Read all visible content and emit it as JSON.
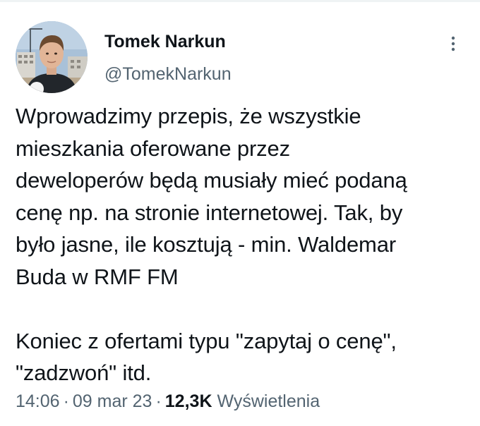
{
  "author": {
    "display_name": "Tomek Narkun",
    "handle": "@TomekNarkun"
  },
  "tweet": {
    "text": "Wprowadzimy przepis, że wszystkie\nmieszkania oferowane przez\ndeweloperów będą musiały mieć podaną\ncenę np. na stronie internetowej. Tak, by\nbyło jasne, ile kosztują - min. Waldemar\nBuda w RMF FM\n\nKoniec z ofertami typu \"zapytaj o cenę\",\n\"zadzwoń\" itd.",
    "time": "14:06",
    "date": "09 mar 23",
    "separator": "·",
    "views_count": "12,3K",
    "views_label": "Wyświetlenia"
  },
  "icons": {
    "more": "more-vertical-icon",
    "avatar": "profile-photo"
  },
  "colors": {
    "text_primary": "#0f1419",
    "text_secondary": "#536471",
    "divider": "#eff3f4"
  }
}
